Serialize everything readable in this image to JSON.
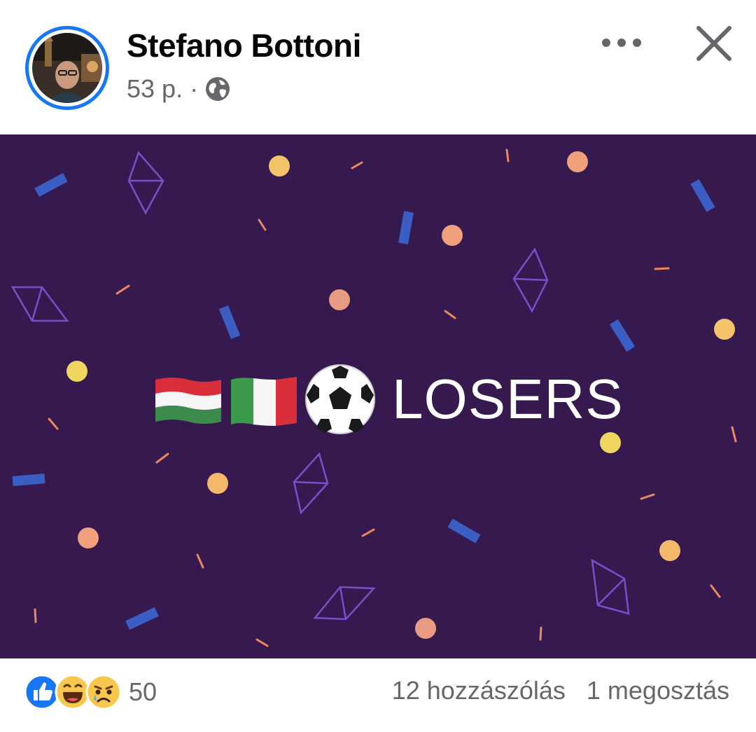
{
  "post": {
    "author": "Stefano Bottoni",
    "time": "53 p.",
    "separator": "·",
    "privacy_icon": "globe-icon"
  },
  "actions": {
    "more_icon": "more-dots-icon",
    "close_icon": "close-icon"
  },
  "content": {
    "emoji": [
      "hungary-flag",
      "italy-flag",
      "soccer-ball"
    ],
    "text": "LOSERS",
    "background": "#361a4f"
  },
  "footer": {
    "reaction_icons": [
      "like-icon",
      "laugh-icon",
      "sad-icon"
    ],
    "reaction_count": "50",
    "comments": "12 hozzászólás",
    "shares": "1 megosztás"
  },
  "colors": {
    "accent": "#1877f2",
    "text_primary": "#050505",
    "text_secondary": "#65676b"
  }
}
